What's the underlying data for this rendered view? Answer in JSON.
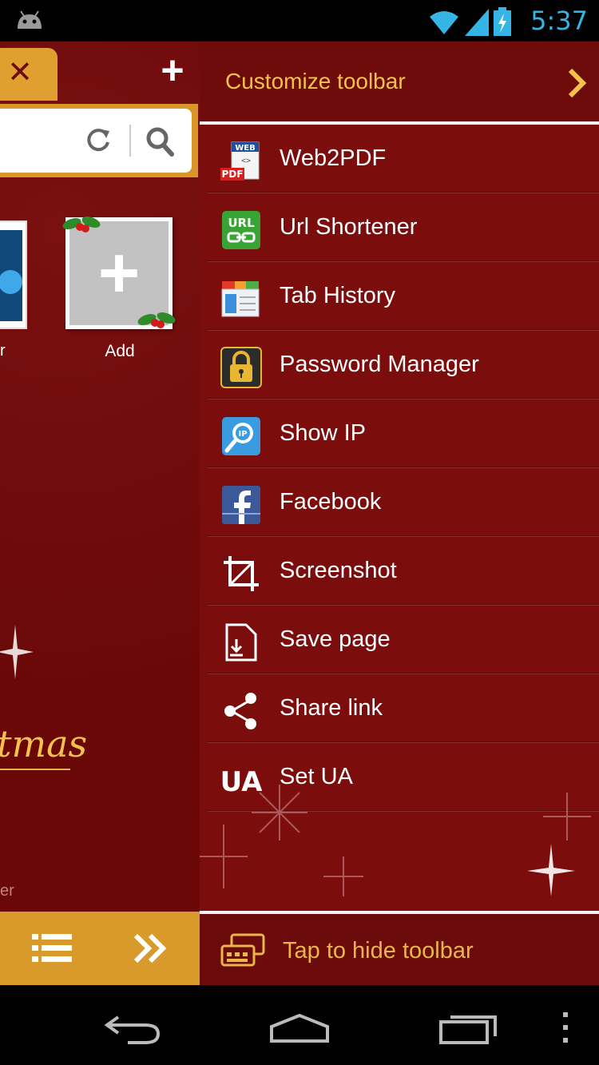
{
  "status_bar": {
    "time": "5:37",
    "icons": [
      "android-icon",
      "wifi-icon",
      "signal-icon",
      "battery-charging-icon"
    ]
  },
  "left_pane": {
    "partial_tile_label": "r",
    "add_label": "Add",
    "xmas_text": "tmas",
    "footer_partial": "er"
  },
  "toolbar_panel": {
    "header": "Customize toolbar",
    "items": [
      {
        "label": "Web2PDF",
        "icon": "web2pdf-icon"
      },
      {
        "label": "Url Shortener",
        "icon": "url-shortener-icon"
      },
      {
        "label": "Tab History",
        "icon": "tab-history-icon"
      },
      {
        "label": "Password Manager",
        "icon": "password-manager-icon"
      },
      {
        "label": "Show IP",
        "icon": "show-ip-icon"
      },
      {
        "label": "Facebook",
        "icon": "facebook-icon"
      },
      {
        "label": "Screenshot",
        "icon": "screenshot-icon"
      },
      {
        "label": "Save page",
        "icon": "save-page-icon"
      },
      {
        "label": "Share link",
        "icon": "share-link-icon"
      },
      {
        "label": "Set UA",
        "icon": "set-ua-icon"
      }
    ],
    "footer": "Tap to hide toolbar"
  },
  "colors": {
    "panel_bg": "#7c0d0d",
    "accent_gold": "#f2c24b",
    "clock_blue": "#35b5e5"
  }
}
